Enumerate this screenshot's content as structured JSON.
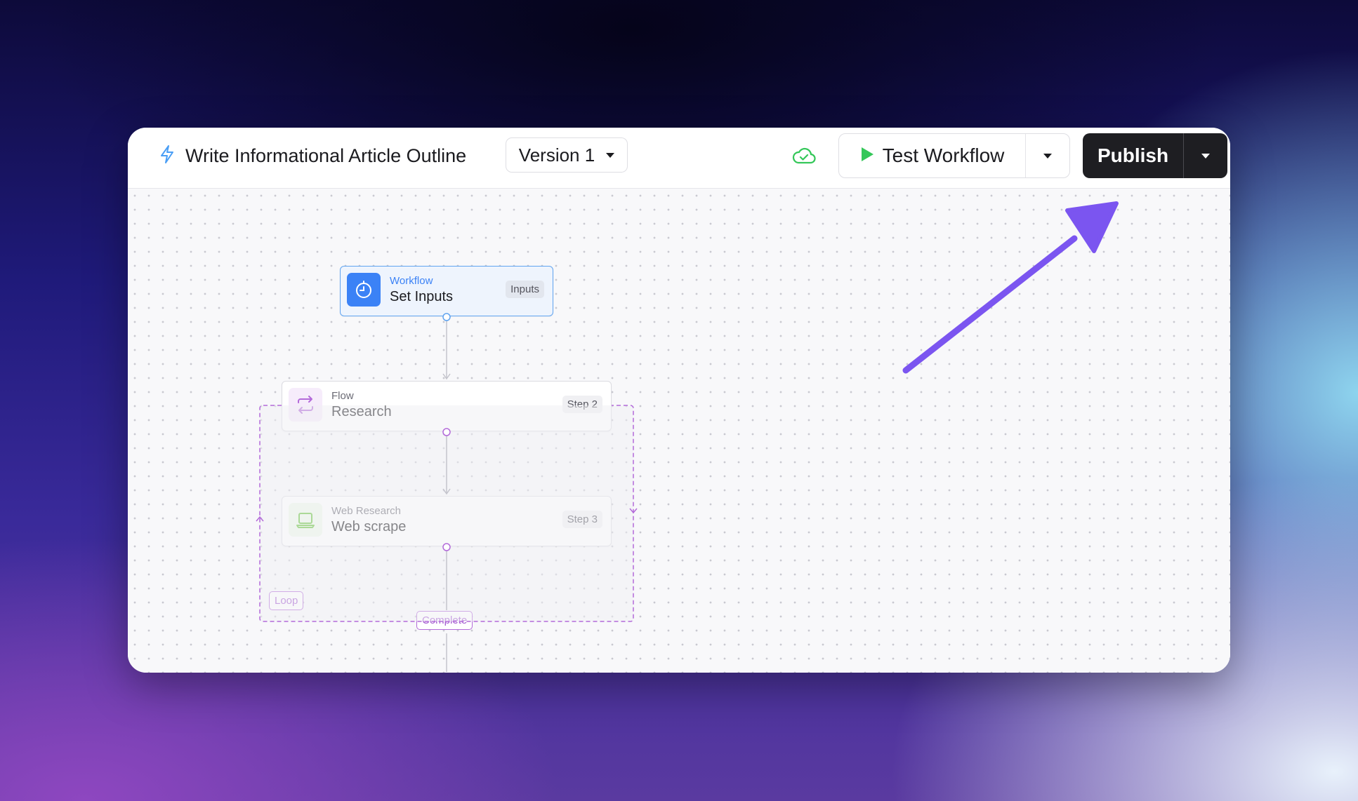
{
  "header": {
    "title": "Write Informational Article Outline",
    "version_label": "Version 1",
    "test_label": "Test Workflow",
    "publish_label": "Publish"
  },
  "nodes": [
    {
      "kind": "Workflow",
      "name": "Set Inputs",
      "badge": "Inputs"
    },
    {
      "kind": "Flow",
      "name": "Research",
      "badge": "Step 2"
    },
    {
      "kind": "Web Research",
      "name": "Web scrape",
      "badge": "Step 3"
    }
  ],
  "loop": {
    "label": "Loop",
    "complete_label": "Complete"
  },
  "colors": {
    "accent_blue": "#3b82f6",
    "loop_purple": "#b36ad9",
    "arrow_purple": "#7b55f0",
    "success_green": "#34c759",
    "publish_dark": "#1e1e22"
  },
  "icons": {
    "title": "lightning-icon",
    "saved": "cloud-check-icon",
    "test": "play-icon",
    "workflow": "timer-icon",
    "flow": "repeat-icon",
    "web_research": "laptop-icon"
  }
}
